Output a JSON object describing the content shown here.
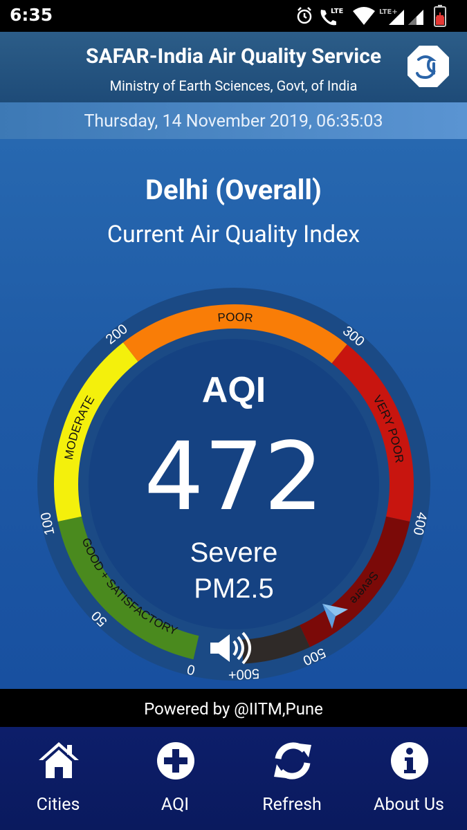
{
  "status_bar": {
    "time": "6:35",
    "network_labels": [
      "LTE",
      "LTE+"
    ]
  },
  "header": {
    "title": "SAFAR-India Air Quality Service",
    "subtitle": "Ministry of Earth Sciences, Govt, of India"
  },
  "datetime": "Thursday, 14 November 2019, 06:35:03",
  "location": {
    "name": "Delhi (Overall)",
    "caption": "Current Air Quality Index"
  },
  "gauge": {
    "aqi_label": "AQI",
    "value": 472,
    "category": "Severe",
    "pollutant": "PM2.5",
    "bands": [
      {
        "label": "GOOD + SATISFACTORY",
        "color": "#4a8a1e"
      },
      {
        "label": "MODERATE",
        "color": "#f4f00c"
      },
      {
        "label": "POOR",
        "color": "#f97d07"
      },
      {
        "label": "VERY POOR",
        "color": "#c8150f"
      },
      {
        "label": "Severe",
        "color": "#7b0a08"
      },
      {
        "label": "",
        "color": "#2f2a28"
      }
    ],
    "ticks": [
      "0",
      "50",
      "100",
      "200",
      "300",
      "400",
      "500",
      "500+"
    ]
  },
  "footer_text": "Powered by @IITM,Pune",
  "nav": [
    {
      "label": "Cities",
      "icon": "home-icon"
    },
    {
      "label": "AQI",
      "icon": "plus-circle-icon"
    },
    {
      "label": "Refresh",
      "icon": "refresh-icon"
    },
    {
      "label": "About Us",
      "icon": "info-icon"
    }
  ],
  "colors": {
    "header": "#26557f",
    "main": "#1f5ba6",
    "navbar": "#0c1c64"
  }
}
